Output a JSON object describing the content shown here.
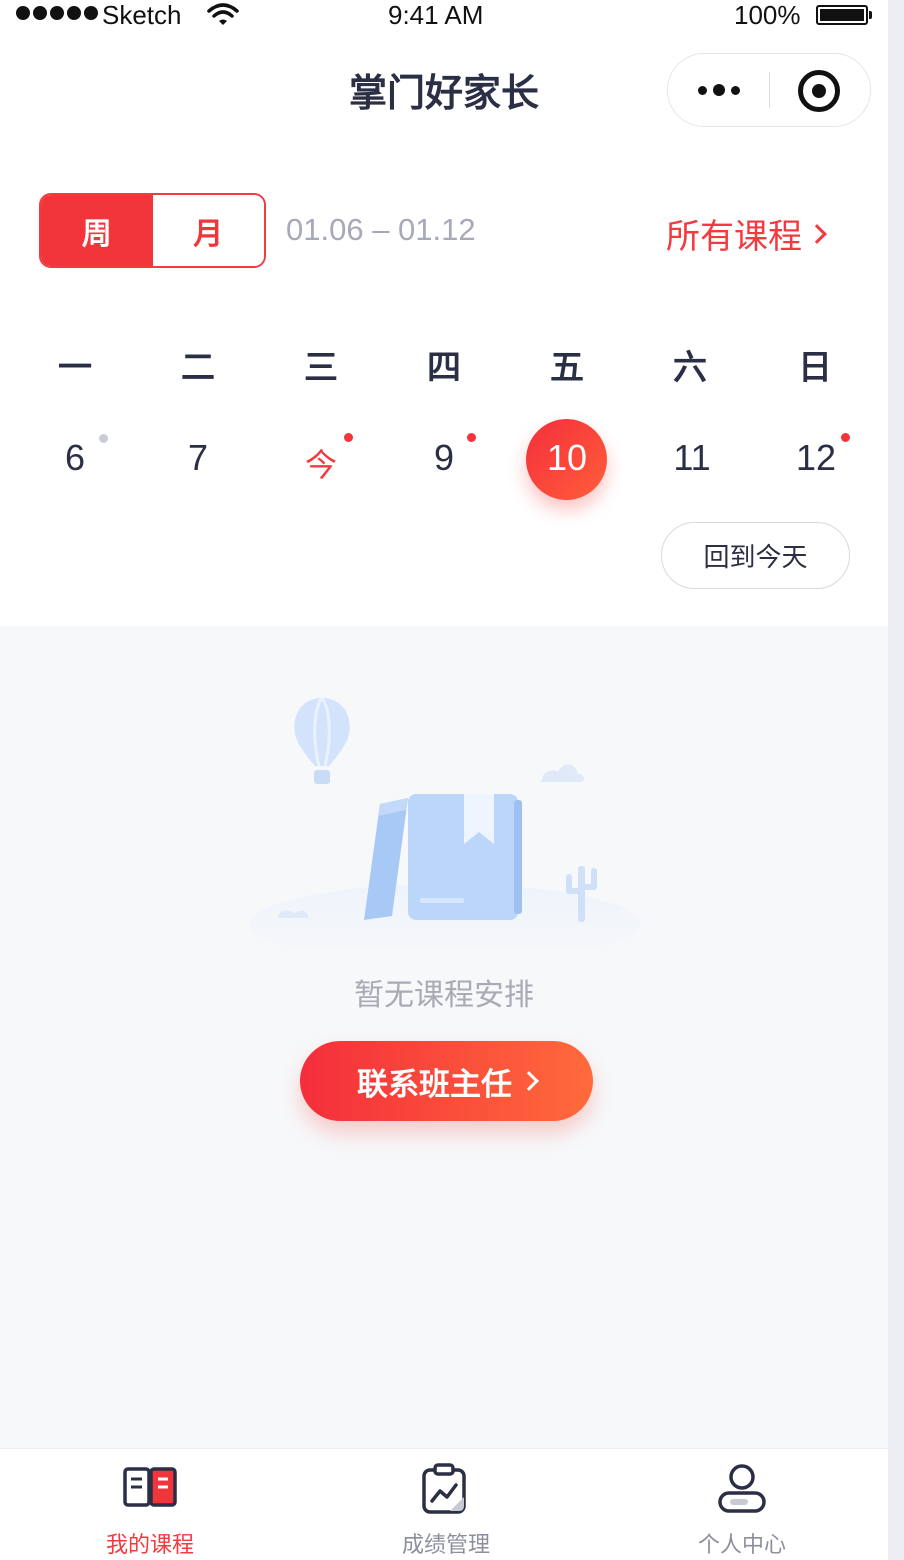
{
  "status_bar": {
    "carrier": "Sketch",
    "time": "9:41 AM",
    "battery": "100%"
  },
  "nav": {
    "title": "掌门好家长"
  },
  "view_toggle": {
    "week": "周",
    "month": "月",
    "active": "week"
  },
  "date_range": "01.06 – 01.12",
  "all_courses": "所有课程",
  "weekdays": [
    "一",
    "二",
    "三",
    "四",
    "五",
    "六",
    "日"
  ],
  "dates": [
    "6",
    "7",
    "今",
    "9",
    "10",
    "11",
    "12"
  ],
  "selected_date": "10",
  "back_today": "回到今天",
  "empty_state": {
    "message": "暂无课程安排",
    "button": "联系班主任"
  },
  "tabbar": {
    "items": [
      {
        "label": "我的课程",
        "icon": "book-icon",
        "active": true
      },
      {
        "label": "成绩管理",
        "icon": "chart-clipboard-icon",
        "active": false
      },
      {
        "label": "个人中心",
        "icon": "user-icon",
        "active": false
      }
    ]
  },
  "colors": {
    "accent": "#F23A3F",
    "text": "#2B2F45",
    "muted": "#A7A9B8"
  }
}
